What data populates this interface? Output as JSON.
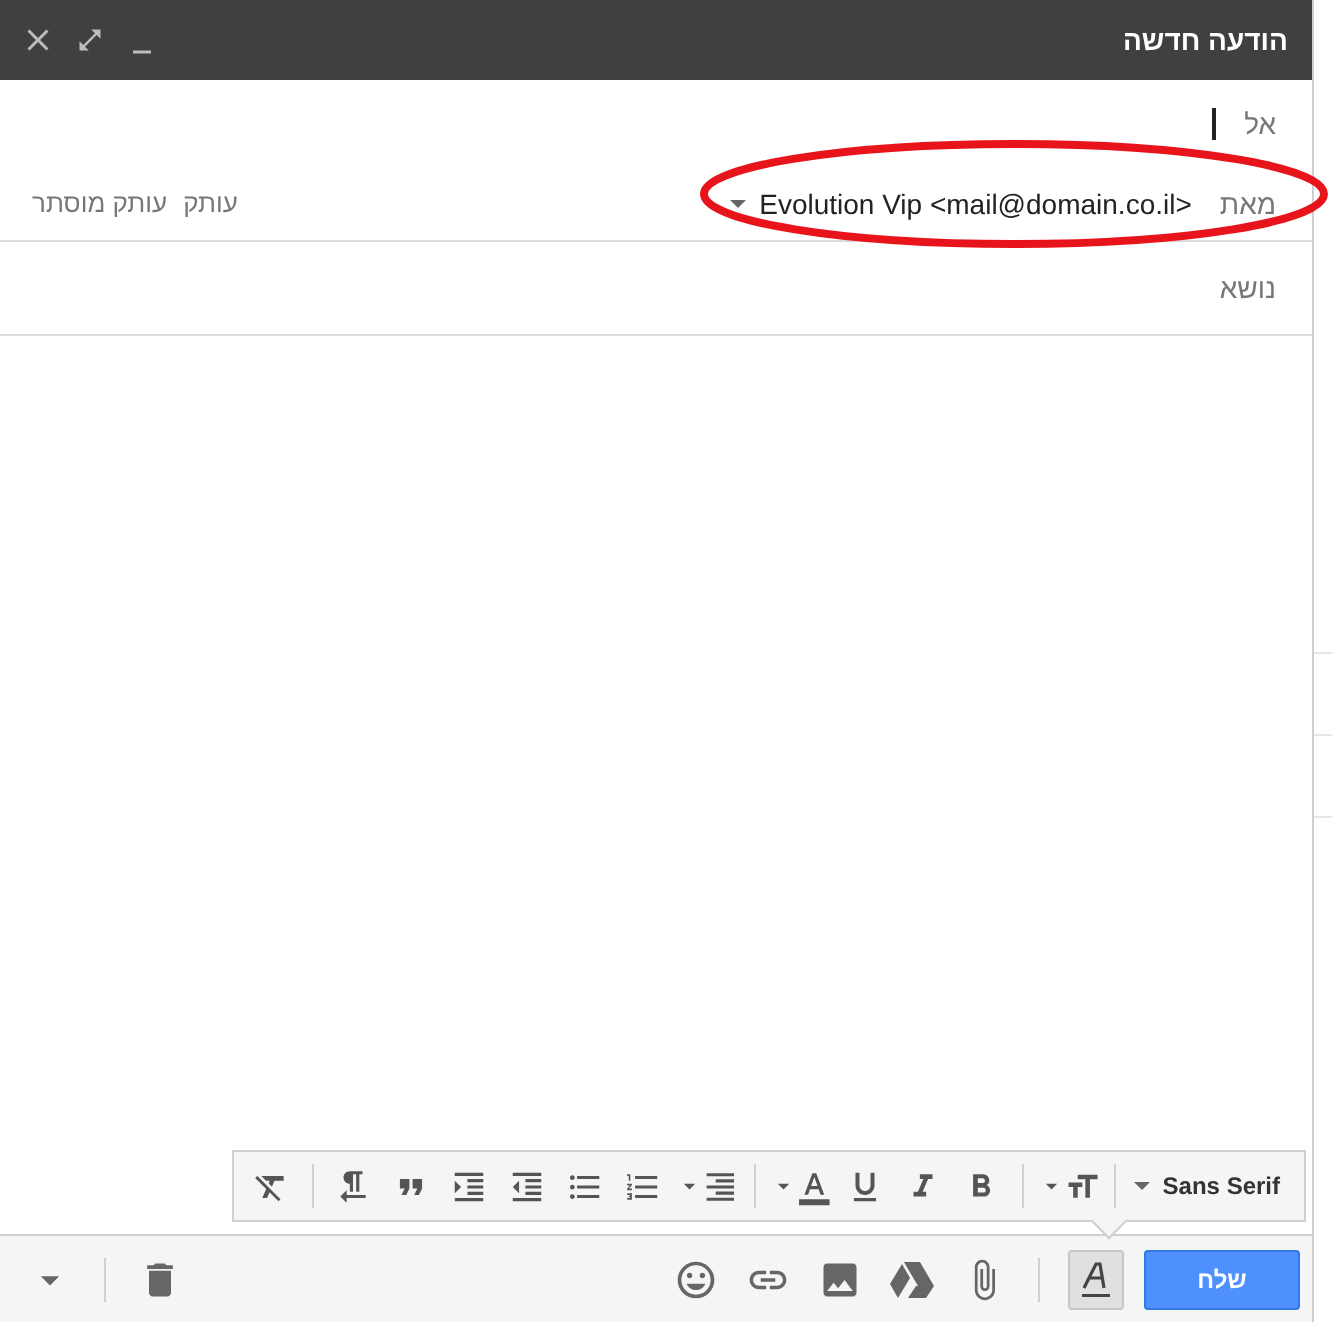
{
  "window": {
    "title": "הודעה חדשה"
  },
  "to": {
    "label": "אל"
  },
  "from": {
    "label": "מאת",
    "value": "Evolution Vip <mail@domain.co.il>"
  },
  "recipient_links": [
    "עותק",
    "עותק מוסתר"
  ],
  "subject": {
    "placeholder": "נושא"
  },
  "format_toolbar": {
    "font": "Sans Serif"
  },
  "formatting_toggle": {
    "selected": true
  },
  "send_button": "שלח"
}
